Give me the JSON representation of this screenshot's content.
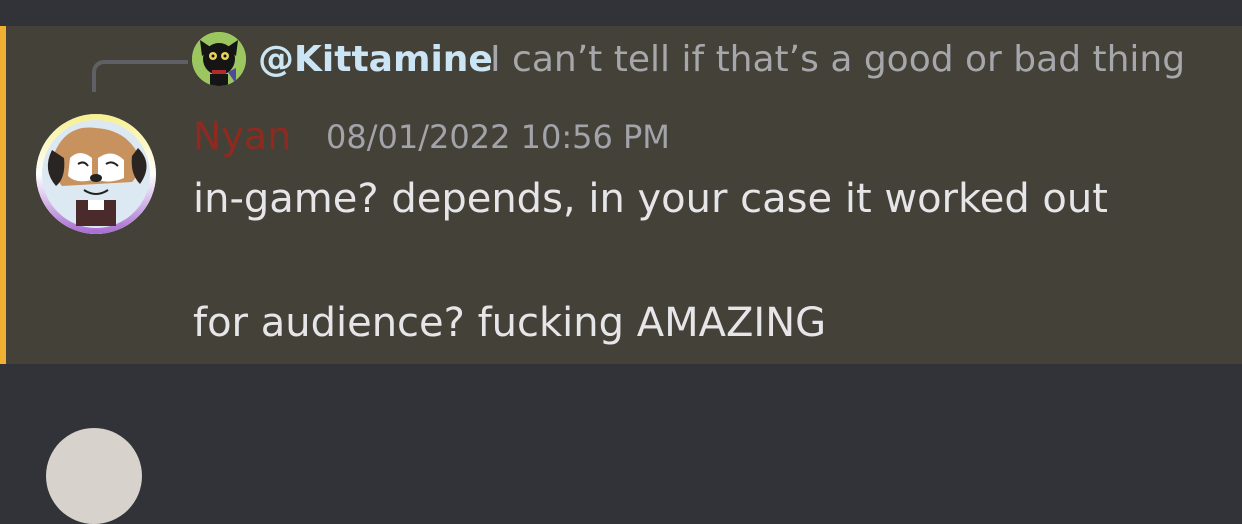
{
  "reply": {
    "author": "@Kittamine",
    "preview": "I can’t tell if that’s a good or bad thing",
    "avatar_icon": "black-cat-avatar"
  },
  "message": {
    "author": "Nyan",
    "timestamp": "08/01/2022 10:56 PM",
    "author_color": "#8f2a1f",
    "avatar_icon": "dog-character-avatar",
    "lines": [
      "in-game? depends, in your case it worked out",
      "for audience? fucking AMAZING"
    ]
  },
  "colors": {
    "highlight_bg": "#444139",
    "accent_bar": "#f0b132",
    "chat_bg": "#313338"
  }
}
